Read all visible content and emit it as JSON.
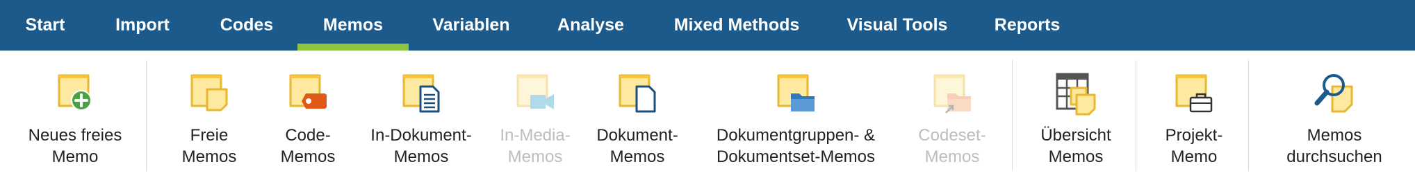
{
  "colors": {
    "tabbar": "#1c5a8c",
    "active_underline": "#8cc63e",
    "memo_yellow": "#fde9a0",
    "memo_border": "#e8b82e",
    "disabled_text": "#bdbdbd"
  },
  "tabs": [
    {
      "label": "Start",
      "active": false
    },
    {
      "label": "Import",
      "active": false
    },
    {
      "label": "Codes",
      "active": false
    },
    {
      "label": "Memos",
      "active": true
    },
    {
      "label": "Variablen",
      "active": false
    },
    {
      "label": "Analyse",
      "active": false
    },
    {
      "label": "Mixed Methods",
      "active": false
    },
    {
      "label": "Visual Tools",
      "active": false
    },
    {
      "label": "Reports",
      "active": false
    }
  ],
  "ribbon": {
    "new_free_memo": {
      "line1": "Neues freies",
      "line2": "Memo",
      "icon": "memo-add-icon",
      "enabled": true
    },
    "free_memos": {
      "line1": "Freie",
      "line2": "Memos",
      "icon": "free-memos-icon",
      "enabled": true
    },
    "code_memos": {
      "line1": "Code-",
      "line2": "Memos",
      "icon": "code-memo-icon",
      "enabled": true
    },
    "in_document_memos": {
      "line1": "In-Dokument-",
      "line2": "Memos",
      "icon": "in-document-memo-icon",
      "enabled": true
    },
    "in_media_memos": {
      "line1": "In-Media-",
      "line2": "Memos",
      "icon": "in-media-memo-icon",
      "enabled": false
    },
    "document_memos": {
      "line1": "Dokument-",
      "line2": "Memos",
      "icon": "document-memo-icon",
      "enabled": true
    },
    "document_group_memos": {
      "line1": "Dokumentgruppen- &",
      "line2": "Dokumentset-Memos",
      "icon": "folder-memo-icon",
      "enabled": true
    },
    "codeset_memos": {
      "line1": "Codeset-",
      "line2": "Memos",
      "icon": "codeset-memo-icon",
      "enabled": false
    },
    "overview_memos": {
      "line1": "Übersicht",
      "line2": "Memos",
      "icon": "table-memo-icon",
      "enabled": true
    },
    "project_memo": {
      "line1": "Projekt-",
      "line2": "Memo",
      "icon": "briefcase-memo-icon",
      "enabled": true
    },
    "search_memos": {
      "line1": "Memos",
      "line2": "durchsuchen",
      "icon": "search-memo-icon",
      "enabled": true
    }
  }
}
